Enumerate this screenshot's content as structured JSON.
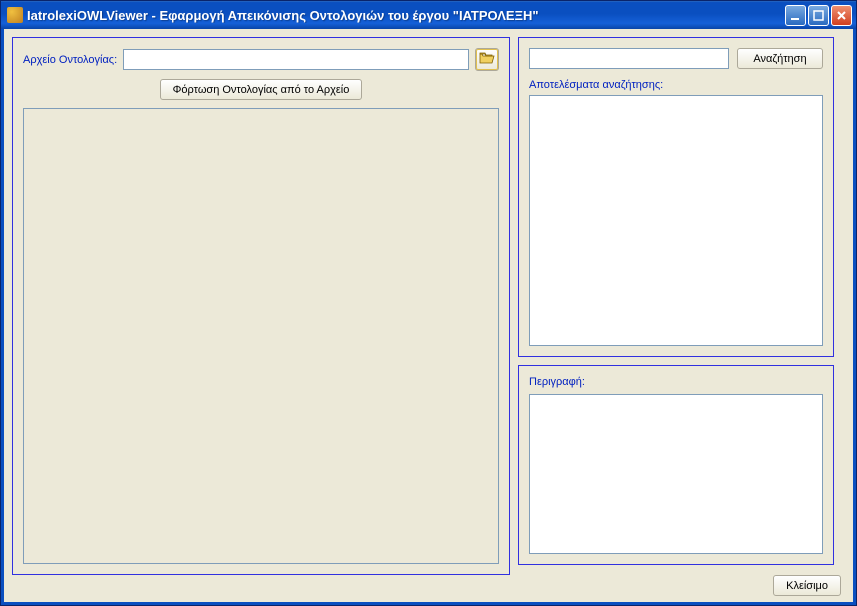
{
  "window": {
    "title": "IatrolexiOWLViewer - Εφαρμογή Απεικόνισης Οντολογιών του έργου \"ΙΑΤΡΟΛΕΞΗ\""
  },
  "left": {
    "file_label": "Αρχείο Οντολογίας:",
    "file_value": "",
    "load_button": "Φόρτωση Οντολογίας από το Αρχείο"
  },
  "right": {
    "search_value": "",
    "search_button": "Αναζήτηση",
    "results_label": "Αποτελέσματα αναζήτησης:",
    "description_label": "Περιγραφή:"
  },
  "footer": {
    "close_button": "Κλείσιμο"
  }
}
